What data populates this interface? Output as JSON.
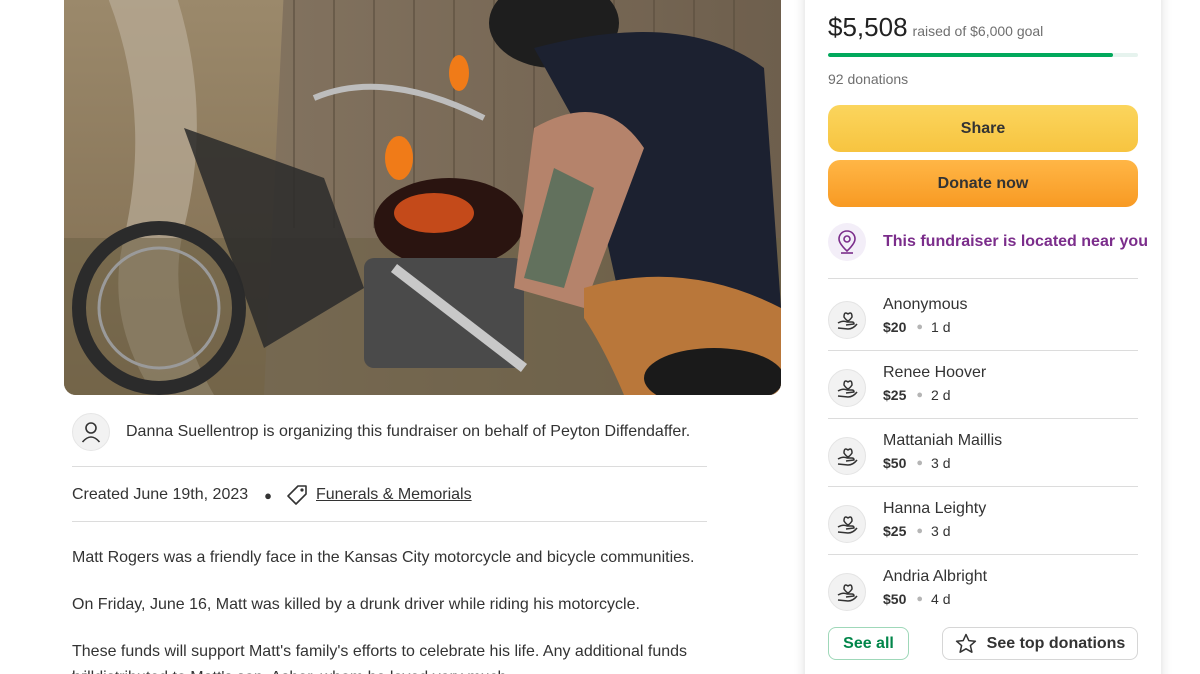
{
  "campaign": {
    "photo_description_icon": "motorcycle-photo",
    "organizer_text": "Danna Suellentrop is organizing this fundraiser on behalf of Peyton Diffendaffer.",
    "created": "Created June 19th, 2023",
    "category": "Funerals & Memorials",
    "story": [
      "Matt Rogers was a friendly face in the Kansas City motorcycle and bicycle communities.",
      "On Friday, June 16, Matt was killed by a drunk driver while riding his motorcycle.",
      "These funds will support Matt's family's efforts to celebrate his life. Any additional funds will",
      "be distributed to Matt's son, Asher, whom he loved very much."
    ]
  },
  "sidebar": {
    "raised_amount": "$5,508",
    "goal_text": "raised of $6,000 goal",
    "progress_fraction": 0.918,
    "donations_count": "92 donations",
    "share_label": "Share",
    "donate_label": "Donate now",
    "near_text": "This fundraiser is located near you",
    "donors": [
      {
        "name": "Anonymous",
        "amount": "$20",
        "time": "1 d"
      },
      {
        "name": "Renee Hoover",
        "amount": "$25",
        "time": "2 d"
      },
      {
        "name": "Mattaniah Maillis",
        "amount": "$50",
        "time": "3 d"
      },
      {
        "name": "Hanna Leighty",
        "amount": "$25",
        "time": "3 d"
      },
      {
        "name": "Andria Albright",
        "amount": "$50",
        "time": "4 d"
      }
    ],
    "see_all_label": "See all",
    "see_top_label": "See top donations"
  },
  "colors": {
    "progress_green": "#02a95c",
    "share_yellow": "#f7c440",
    "donate_orange": "#f89a23",
    "near_purple": "#7b2d8b"
  }
}
